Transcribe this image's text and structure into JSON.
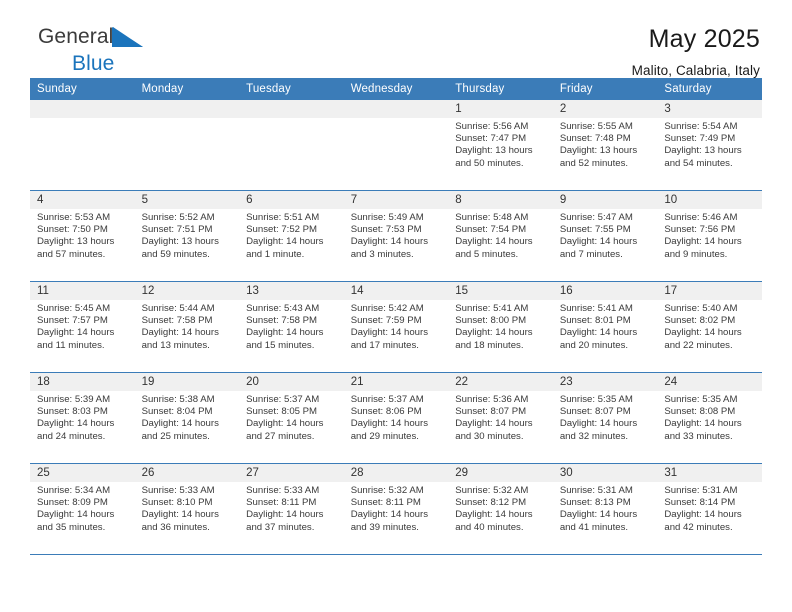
{
  "brand": {
    "name_top": "General",
    "name_bottom": "Blue",
    "triangle_color": "#1b74bc"
  },
  "header": {
    "title": "May 2025",
    "subtitle": "Malito, Calabria, Italy"
  },
  "colors": {
    "header_blue": "#3b7cb8",
    "daynum_band": "#f0f0f0",
    "text": "#3a3a3a"
  },
  "weekdays": [
    "Sunday",
    "Monday",
    "Tuesday",
    "Wednesday",
    "Thursday",
    "Friday",
    "Saturday"
  ],
  "labels": {
    "sunrise": "Sunrise:",
    "sunset": "Sunset:",
    "daylight": "Daylight:"
  },
  "weeks": [
    [
      {
        "day": "",
        "sunrise": "",
        "sunset": "",
        "daylight": "",
        "empty": true
      },
      {
        "day": "",
        "sunrise": "",
        "sunset": "",
        "daylight": "",
        "empty": true
      },
      {
        "day": "",
        "sunrise": "",
        "sunset": "",
        "daylight": "",
        "empty": true
      },
      {
        "day": "",
        "sunrise": "",
        "sunset": "",
        "daylight": "",
        "empty": true
      },
      {
        "day": "1",
        "sunrise": "Sunrise: 5:56 AM",
        "sunset": "Sunset: 7:47 PM",
        "daylight": "Daylight: 13 hours and 50 minutes."
      },
      {
        "day": "2",
        "sunrise": "Sunrise: 5:55 AM",
        "sunset": "Sunset: 7:48 PM",
        "daylight": "Daylight: 13 hours and 52 minutes."
      },
      {
        "day": "3",
        "sunrise": "Sunrise: 5:54 AM",
        "sunset": "Sunset: 7:49 PM",
        "daylight": "Daylight: 13 hours and 54 minutes."
      }
    ],
    [
      {
        "day": "4",
        "sunrise": "Sunrise: 5:53 AM",
        "sunset": "Sunset: 7:50 PM",
        "daylight": "Daylight: 13 hours and 57 minutes."
      },
      {
        "day": "5",
        "sunrise": "Sunrise: 5:52 AM",
        "sunset": "Sunset: 7:51 PM",
        "daylight": "Daylight: 13 hours and 59 minutes."
      },
      {
        "day": "6",
        "sunrise": "Sunrise: 5:51 AM",
        "sunset": "Sunset: 7:52 PM",
        "daylight": "Daylight: 14 hours and 1 minute."
      },
      {
        "day": "7",
        "sunrise": "Sunrise: 5:49 AM",
        "sunset": "Sunset: 7:53 PM",
        "daylight": "Daylight: 14 hours and 3 minutes."
      },
      {
        "day": "8",
        "sunrise": "Sunrise: 5:48 AM",
        "sunset": "Sunset: 7:54 PM",
        "daylight": "Daylight: 14 hours and 5 minutes."
      },
      {
        "day": "9",
        "sunrise": "Sunrise: 5:47 AM",
        "sunset": "Sunset: 7:55 PM",
        "daylight": "Daylight: 14 hours and 7 minutes."
      },
      {
        "day": "10",
        "sunrise": "Sunrise: 5:46 AM",
        "sunset": "Sunset: 7:56 PM",
        "daylight": "Daylight: 14 hours and 9 minutes."
      }
    ],
    [
      {
        "day": "11",
        "sunrise": "Sunrise: 5:45 AM",
        "sunset": "Sunset: 7:57 PM",
        "daylight": "Daylight: 14 hours and 11 minutes."
      },
      {
        "day": "12",
        "sunrise": "Sunrise: 5:44 AM",
        "sunset": "Sunset: 7:58 PM",
        "daylight": "Daylight: 14 hours and 13 minutes."
      },
      {
        "day": "13",
        "sunrise": "Sunrise: 5:43 AM",
        "sunset": "Sunset: 7:58 PM",
        "daylight": "Daylight: 14 hours and 15 minutes."
      },
      {
        "day": "14",
        "sunrise": "Sunrise: 5:42 AM",
        "sunset": "Sunset: 7:59 PM",
        "daylight": "Daylight: 14 hours and 17 minutes."
      },
      {
        "day": "15",
        "sunrise": "Sunrise: 5:41 AM",
        "sunset": "Sunset: 8:00 PM",
        "daylight": "Daylight: 14 hours and 18 minutes."
      },
      {
        "day": "16",
        "sunrise": "Sunrise: 5:41 AM",
        "sunset": "Sunset: 8:01 PM",
        "daylight": "Daylight: 14 hours and 20 minutes."
      },
      {
        "day": "17",
        "sunrise": "Sunrise: 5:40 AM",
        "sunset": "Sunset: 8:02 PM",
        "daylight": "Daylight: 14 hours and 22 minutes."
      }
    ],
    [
      {
        "day": "18",
        "sunrise": "Sunrise: 5:39 AM",
        "sunset": "Sunset: 8:03 PM",
        "daylight": "Daylight: 14 hours and 24 minutes."
      },
      {
        "day": "19",
        "sunrise": "Sunrise: 5:38 AM",
        "sunset": "Sunset: 8:04 PM",
        "daylight": "Daylight: 14 hours and 25 minutes."
      },
      {
        "day": "20",
        "sunrise": "Sunrise: 5:37 AM",
        "sunset": "Sunset: 8:05 PM",
        "daylight": "Daylight: 14 hours and 27 minutes."
      },
      {
        "day": "21",
        "sunrise": "Sunrise: 5:37 AM",
        "sunset": "Sunset: 8:06 PM",
        "daylight": "Daylight: 14 hours and 29 minutes."
      },
      {
        "day": "22",
        "sunrise": "Sunrise: 5:36 AM",
        "sunset": "Sunset: 8:07 PM",
        "daylight": "Daylight: 14 hours and 30 minutes."
      },
      {
        "day": "23",
        "sunrise": "Sunrise: 5:35 AM",
        "sunset": "Sunset: 8:07 PM",
        "daylight": "Daylight: 14 hours and 32 minutes."
      },
      {
        "day": "24",
        "sunrise": "Sunrise: 5:35 AM",
        "sunset": "Sunset: 8:08 PM",
        "daylight": "Daylight: 14 hours and 33 minutes."
      }
    ],
    [
      {
        "day": "25",
        "sunrise": "Sunrise: 5:34 AM",
        "sunset": "Sunset: 8:09 PM",
        "daylight": "Daylight: 14 hours and 35 minutes."
      },
      {
        "day": "26",
        "sunrise": "Sunrise: 5:33 AM",
        "sunset": "Sunset: 8:10 PM",
        "daylight": "Daylight: 14 hours and 36 minutes."
      },
      {
        "day": "27",
        "sunrise": "Sunrise: 5:33 AM",
        "sunset": "Sunset: 8:11 PM",
        "daylight": "Daylight: 14 hours and 37 minutes."
      },
      {
        "day": "28",
        "sunrise": "Sunrise: 5:32 AM",
        "sunset": "Sunset: 8:11 PM",
        "daylight": "Daylight: 14 hours and 39 minutes."
      },
      {
        "day": "29",
        "sunrise": "Sunrise: 5:32 AM",
        "sunset": "Sunset: 8:12 PM",
        "daylight": "Daylight: 14 hours and 40 minutes."
      },
      {
        "day": "30",
        "sunrise": "Sunrise: 5:31 AM",
        "sunset": "Sunset: 8:13 PM",
        "daylight": "Daylight: 14 hours and 41 minutes."
      },
      {
        "day": "31",
        "sunrise": "Sunrise: 5:31 AM",
        "sunset": "Sunset: 8:14 PM",
        "daylight": "Daylight: 14 hours and 42 minutes."
      }
    ]
  ]
}
